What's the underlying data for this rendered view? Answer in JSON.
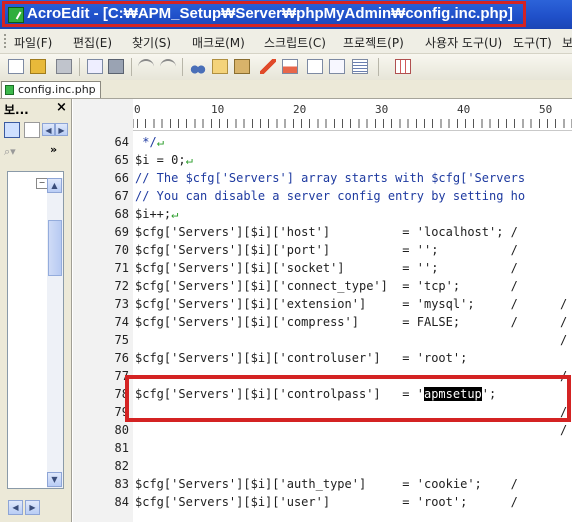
{
  "window": {
    "app_name": "AcroEdit",
    "title": "AcroEdit - [C:₩APM_Setup₩Server₩phpMyAdmin₩config.inc.php]"
  },
  "menu": [
    "파일(F)",
    "편집(E)",
    "찾기(S)",
    "매크로(M)",
    "스크립트(C)",
    "프로젝트(P)",
    "사용자 도구(U)",
    "도구(T)",
    "보"
  ],
  "file_tab": {
    "label": "config.inc.php"
  },
  "left_panel": {
    "title": "보...",
    "close": "×"
  },
  "ruler": {
    "labels": [
      "0",
      "10",
      "20",
      "30",
      "40",
      "50"
    ]
  },
  "lines": [
    {
      "num": "64",
      "code": " */",
      "ret": "↵",
      "kind": "comment"
    },
    {
      "num": "65",
      "code": "$i = 0;",
      "ret": "↵",
      "kind": "code"
    },
    {
      "num": "66",
      "code": "// The $cfg['Servers'] array starts with $cfg['Servers",
      "ret": "",
      "kind": "comment"
    },
    {
      "num": "67",
      "code": "// You can disable a server config entry by setting ho",
      "ret": "",
      "kind": "comment"
    },
    {
      "num": "68",
      "code": "$i++;",
      "ret": "↵",
      "kind": "code"
    },
    {
      "num": "69",
      "code": "$cfg['Servers'][$i]['host']          = 'localhost'; /",
      "ret": "",
      "kind": "code"
    },
    {
      "num": "70",
      "code": "$cfg['Servers'][$i]['port']          = '';          /",
      "ret": "",
      "kind": "code"
    },
    {
      "num": "71",
      "code": "$cfg['Servers'][$i]['socket']        = '';          /",
      "ret": "",
      "kind": "code"
    },
    {
      "num": "72",
      "code": "$cfg['Servers'][$i]['connect_type']  = 'tcp';       /",
      "ret": "",
      "kind": "code"
    },
    {
      "num": "73",
      "code": "$cfg['Servers'][$i]['extension']     = 'mysql';     /",
      "ret": "",
      "kind": "code"
    },
    {
      "num": "74",
      "code": "$cfg['Servers'][$i]['compress']      = FALSE;       /",
      "ret": "",
      "kind": "code"
    },
    {
      "num": "75",
      "code": "",
      "ret": "",
      "kind": "code"
    },
    {
      "num": "76",
      "code": "$cfg['Servers'][$i]['controluser']   = 'root';",
      "ret": "",
      "kind": "code"
    },
    {
      "num": "77",
      "code": "",
      "ret": "",
      "kind": "code"
    },
    {
      "num": "78",
      "code_before": "$cfg['Servers'][$i]['controlpass']   = '",
      "selected": "apmsetup",
      "code_after": "';",
      "kind": "selected"
    },
    {
      "num": "79",
      "code": "",
      "ret": "",
      "kind": "code"
    },
    {
      "num": "80",
      "code": "",
      "ret": "",
      "kind": "code"
    },
    {
      "num": "81",
      "code": "",
      "ret": "",
      "kind": "code"
    },
    {
      "num": "82",
      "code": "",
      "ret": "",
      "kind": "code"
    },
    {
      "num": "83",
      "code": "$cfg['Servers'][$i]['auth_type']     = 'cookie';    /",
      "ret": "",
      "kind": "code"
    },
    {
      "num": "84",
      "code": "$cfg['Servers'][$i]['user']          = 'root';      /",
      "ret": "",
      "kind": "code"
    }
  ],
  "right_tails": [
    "/",
    "/",
    "/",
    "/",
    "/",
    "/"
  ],
  "colors": {
    "highlight": "#d42323",
    "titlebar": "#1f4fc8",
    "comment": "#1e3aa0"
  }
}
